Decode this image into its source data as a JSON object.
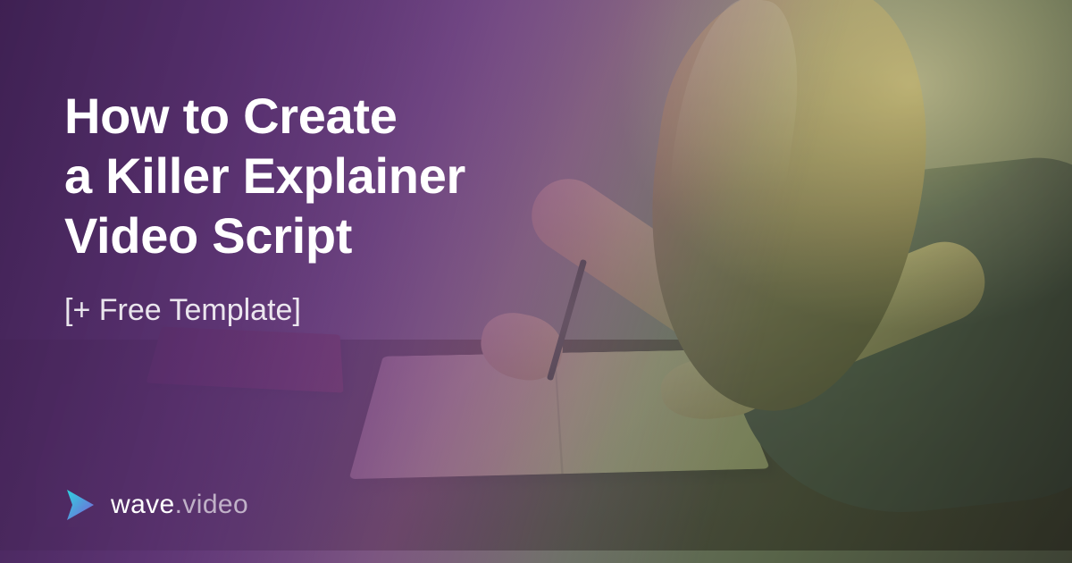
{
  "headline": {
    "line1": "How to Create",
    "line2": "a Killer Explainer",
    "line3": "Video Script"
  },
  "subheadline": "[+ Free Template]",
  "brand": {
    "prefix": "wave",
    "suffix": ".video"
  },
  "colors": {
    "overlay_start": "#3e2052",
    "overlay_mid": "#6e4284",
    "logo_gradient_start": "#2dd4e0",
    "logo_gradient_end": "#7b5fd9"
  }
}
